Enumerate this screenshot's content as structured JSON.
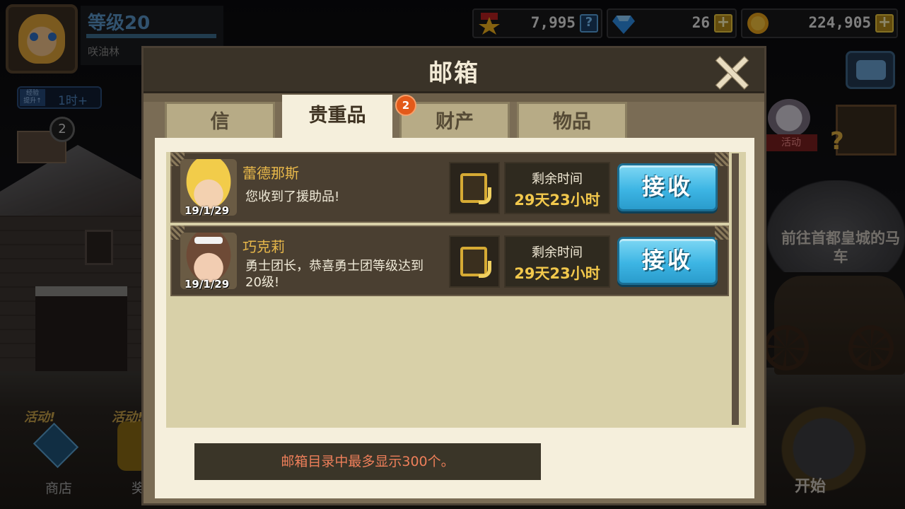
{
  "player": {
    "level": "等级20",
    "name": "咲油林",
    "level_progress": 1.0,
    "exp_boost_label": "经验\n提升↑",
    "exp_boost_time": "1时+",
    "mail_count": "2"
  },
  "currencies": {
    "medal": {
      "icon": "medal-icon",
      "value": "7,995"
    },
    "gem": {
      "icon": "gem-icon",
      "value": "26"
    },
    "gold": {
      "icon": "gold-coin-icon",
      "value": "224,905"
    }
  },
  "side": {
    "event_tag": "活动",
    "carriage_text": "前往首都皇城的马车",
    "start_label": "开始"
  },
  "bottom_left": {
    "shop_event": "活动!",
    "shop_label": "商店",
    "second_event": "活动!",
    "second_label": "奖"
  },
  "mailbox": {
    "title": "邮箱",
    "tabs": [
      {
        "label": "信",
        "active": false
      },
      {
        "label": "贵重品",
        "active": true,
        "badge": "2"
      },
      {
        "label": "财产",
        "active": false
      },
      {
        "label": "物品",
        "active": false
      }
    ],
    "mails": [
      {
        "sender": "蕾德那斯",
        "date": "19/1/29",
        "message": "您收到了援助品!",
        "time_label": "剩余时间",
        "time_value": "29天23小时",
        "button": "接收"
      },
      {
        "sender": "巧克莉",
        "date": "19/1/29",
        "message": "勇士团长，恭喜勇士团等级达到20级!",
        "time_label": "剩余时间",
        "time_value": "29天23小时",
        "button": "接收"
      }
    ],
    "footer": "邮箱目录中最多显示300个。"
  },
  "colors": {
    "accent_button": "#3db5e4",
    "sender_name": "#e8b84a",
    "time_value": "#f2c84c",
    "footer_text": "#ee7f5a",
    "badge": "#e35a1a"
  }
}
